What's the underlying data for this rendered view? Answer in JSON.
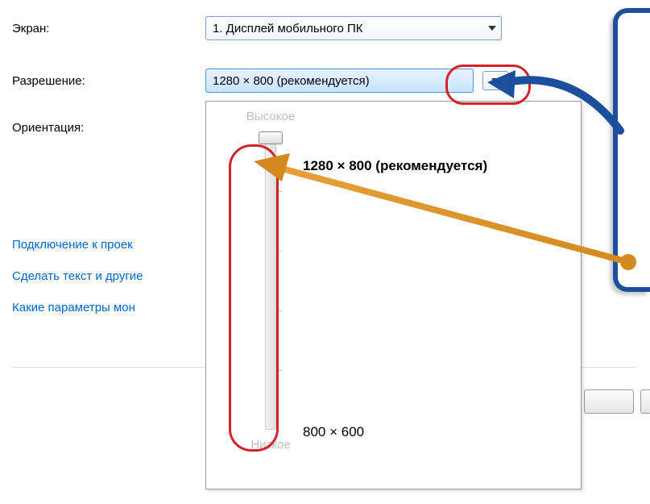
{
  "labels": {
    "screen": "Экран:",
    "resolution": "Разрешение:",
    "orientation": "Ориентация:"
  },
  "dropdowns": {
    "screen_value": "1. Дисплей мобильного ПК",
    "resolution_value": "1280 × 800 (рекомендуется)"
  },
  "links": {
    "projector": "Подключение к проек",
    "textsize": "Сделать текст и другие",
    "monitor": "Какие параметры мон"
  },
  "slider": {
    "high": "Высокое",
    "low": "Низкое",
    "top_value": "1280 × 800 (рекомендуется)",
    "bottom_value": "800 × 600"
  }
}
